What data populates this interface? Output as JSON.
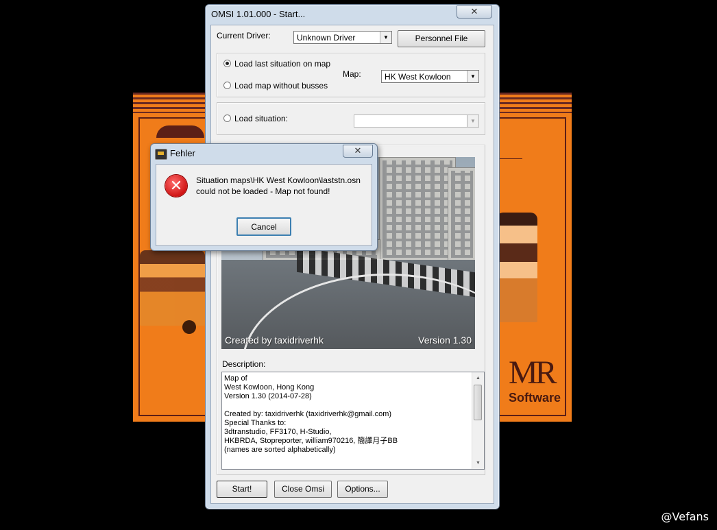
{
  "main_window": {
    "title": "OMSI 1.01.000 - Start...",
    "close_glyph": "✕",
    "current_driver_label": "Current Driver:",
    "current_driver_value": "Unknown Driver",
    "personnel_file_label": "Personnel File",
    "load_last_label": "Load last situation on map",
    "load_without_busses_label": "Load map without busses",
    "map_label": "Map:",
    "map_value": "HK West Kowloon",
    "load_situation_label": "Load situation:",
    "load_situation_value": "",
    "preview_caption_left": "Created by taxidriverhk",
    "preview_caption_right": "Version 1.30",
    "description_label": "Description:",
    "description_text": "Map of\nWest Kowloon, Hong Kong\nVersion 1.30 (2014-07-28)\n\nCreated by: taxidriverhk (taxidriverhk@gmail.com)\nSpecial Thanks to:\n3dtranstudio, FF3170, H-Studio,\nHKBRDA, Stopreporter, william970216, 簡譯月子BB\n(names are sorted alphabetically)",
    "start_label": "Start!",
    "close_omsi_label": "Close Omsi",
    "options_label": "Options..."
  },
  "error_dialog": {
    "title": "Fehler",
    "close_glyph": "✕",
    "message": "Situation maps\\HK West Kowloon\\laststn.osn could not be loaded - Map not found!",
    "cancel_label": "Cancel"
  },
  "splash": {
    "logo_mark": "MR",
    "logo_text": "Software"
  },
  "watermark": "@Vefans",
  "colors": {
    "splash_orange": "#f07c1a",
    "window_frame": "#cfdcea",
    "error_red": "#d01515"
  }
}
